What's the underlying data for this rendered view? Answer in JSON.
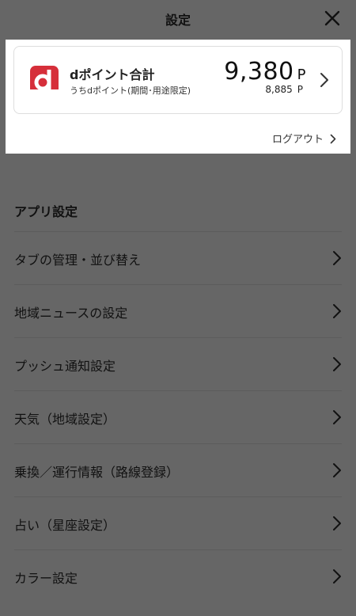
{
  "header": {
    "title": "設定"
  },
  "points_card": {
    "title": "dポイント合計",
    "subtitle": "うちdポイント(期間･用途限定)",
    "total_points": "9,380",
    "total_unit": "P",
    "limited_points": "8,885",
    "limited_unit": "P",
    "logo_color": "#d62f3a"
  },
  "logout": {
    "label": "ログアウト"
  },
  "app_settings": {
    "title": "アプリ設定",
    "items": [
      {
        "label": "タブの管理・並び替え"
      },
      {
        "label": "地域ニュースの設定"
      },
      {
        "label": "プッシュ通知設定"
      },
      {
        "label": "天気（地域設定）"
      },
      {
        "label": "乗換／運行情報（路線登録）"
      },
      {
        "label": "占い（星座設定）"
      },
      {
        "label": "カラー設定"
      }
    ]
  },
  "colors": {
    "overlay_background": "#666666",
    "panel_background": "#ffffff"
  }
}
